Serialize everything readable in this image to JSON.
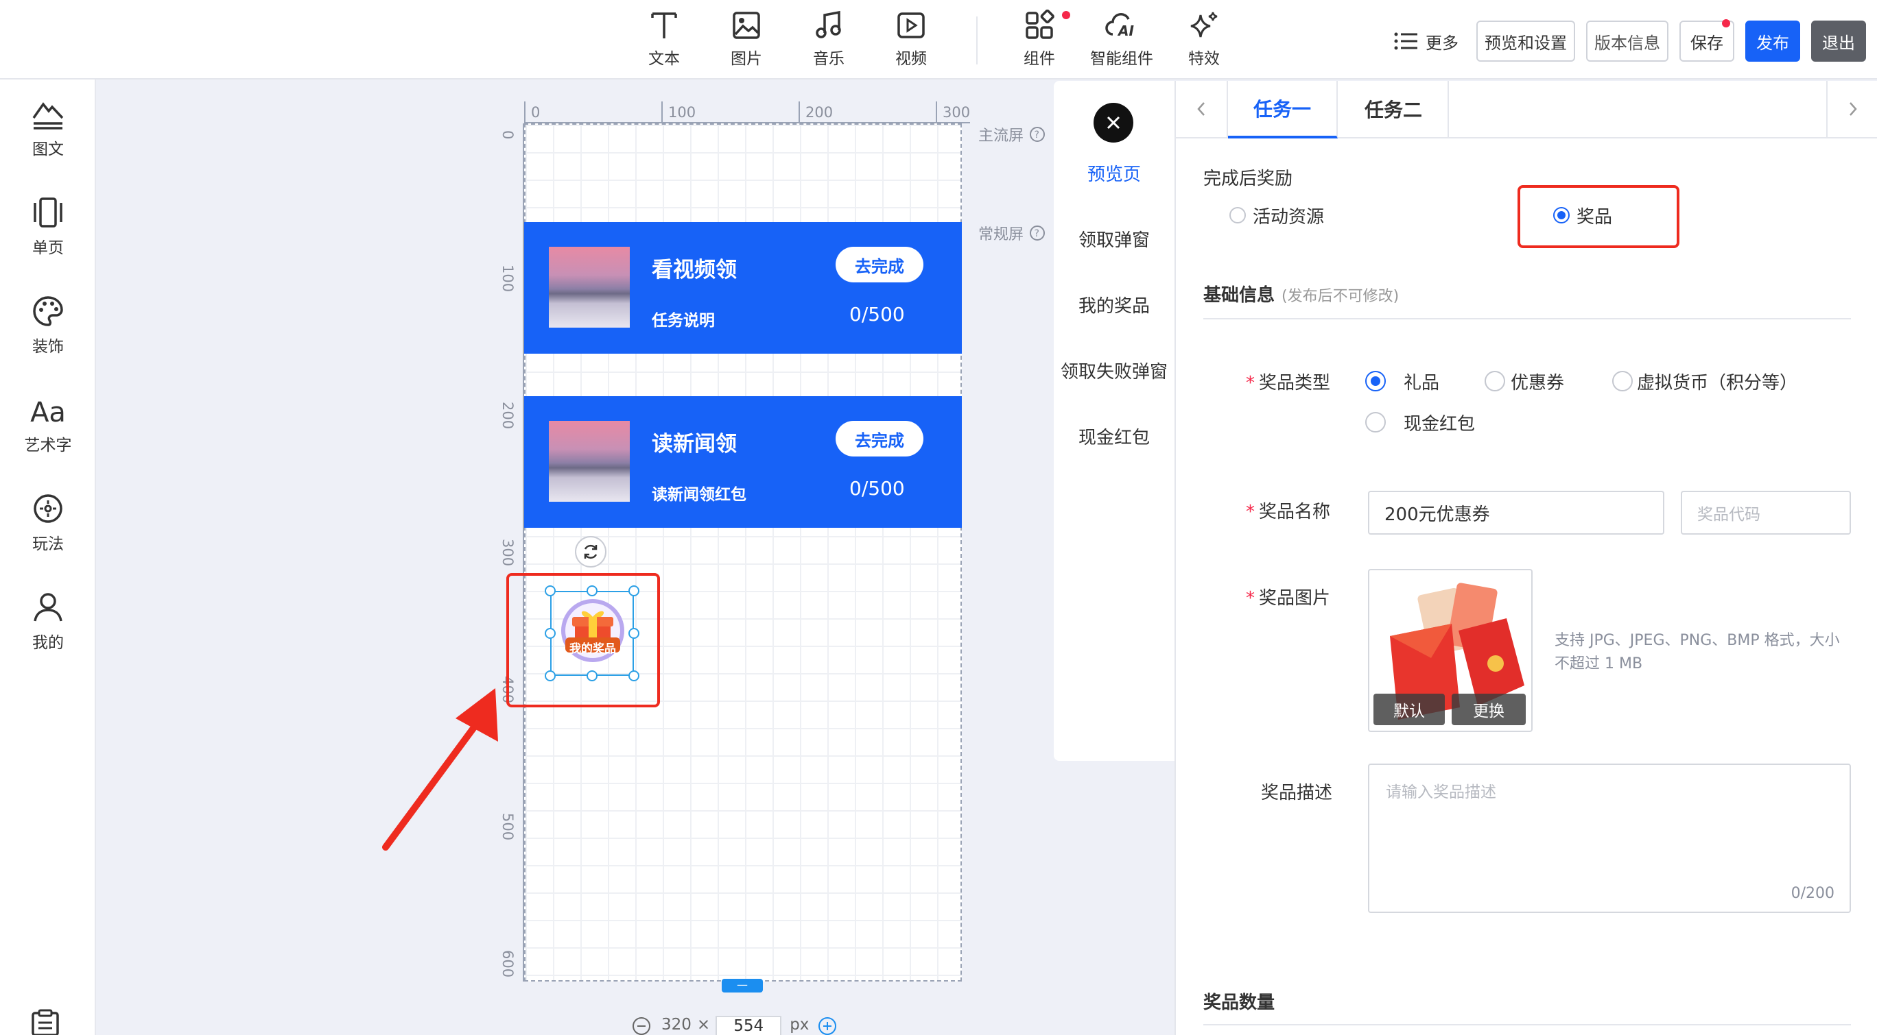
{
  "toolbar": {
    "tools": [
      {
        "label": "文本",
        "icon": "text-icon"
      },
      {
        "label": "图片",
        "icon": "image-icon"
      },
      {
        "label": "音乐",
        "icon": "music-icon"
      },
      {
        "label": "视频",
        "icon": "video-icon"
      },
      {
        "label": "组件",
        "icon": "components-icon"
      },
      {
        "label": "智能组件",
        "icon": "ai-cloud-icon"
      },
      {
        "label": "特效",
        "icon": "sparkle-icon"
      }
    ],
    "more": "更多",
    "preview_settings": "预览和设置",
    "version_info": "版本信息",
    "save": "保存",
    "publish": "发布",
    "exit": "退出"
  },
  "sidebar": {
    "items": [
      {
        "label": "图文"
      },
      {
        "label": "单页"
      },
      {
        "label": "装饰"
      },
      {
        "label": "艺术字",
        "glyph": "Aa"
      },
      {
        "label": "玩法"
      },
      {
        "label": "我的"
      }
    ]
  },
  "canvas": {
    "ruler_top": [
      "0",
      "100",
      "200",
      "300"
    ],
    "ruler_left": [
      "0",
      "100",
      "200",
      "300",
      "400",
      "500",
      "600"
    ],
    "main_screen": "主流屏",
    "normal_screen": "常规屏",
    "width": "320",
    "times": "×",
    "height": "554",
    "unit": "px",
    "cards": [
      {
        "title": "看视频领",
        "subtitle": "任务说明",
        "button": "去完成",
        "count": "0/500"
      },
      {
        "title": "读新闻领",
        "subtitle": "读新闻领红包",
        "button": "去完成",
        "count": "0/500"
      }
    ],
    "prize_icon_label": "我的奖品",
    "bottom_handle": "—"
  },
  "page_nav": {
    "items": [
      "预览页",
      "领取弹窗",
      "我的奖品",
      "领取失败弹窗",
      "现金红包"
    ],
    "active": 0
  },
  "panel": {
    "tabs": [
      "任务一",
      "任务二"
    ],
    "active_tab": 0,
    "reward_title": "完成后奖励",
    "reward_options": [
      "活动资源",
      "奖品"
    ],
    "reward_selected": 1,
    "basic_info": "基础信息",
    "basic_info_note": "(发布后不可修改)",
    "prize_type_label": "奖品类型",
    "prize_types": [
      "礼品",
      "优惠券",
      "虚拟货币（积分等）",
      "现金红包"
    ],
    "prize_type_selected": 0,
    "prize_name_label": "奖品名称",
    "prize_name_value": "200元优惠券",
    "prize_code_placeholder": "奖品代码",
    "prize_image_label": "奖品图片",
    "image_btn_default": "默认",
    "image_btn_change": "更换",
    "image_hint": "支持 JPG、JPEG、PNG、BMP 格式，大小不超过 1 MB",
    "prize_desc_label": "奖品描述",
    "prize_desc_placeholder": "请输入奖品描述",
    "prize_desc_count": "0/200",
    "prize_qty_label": "奖品数量"
  },
  "colors": {
    "accent": "#1762f7",
    "highlight_red": "#ee2b1f",
    "dot_red": "#f5284a"
  }
}
